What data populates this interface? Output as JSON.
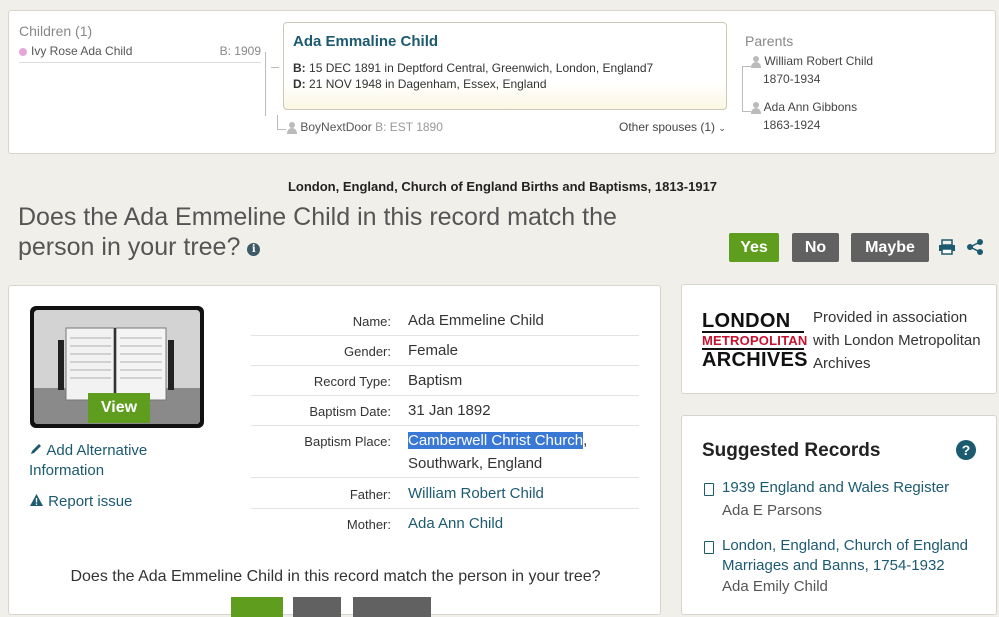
{
  "family": {
    "children_heading": "Children (1)",
    "children": [
      {
        "name": "Ivy Rose Ada Child",
        "birth": "B: 1909"
      }
    ],
    "focus": {
      "name": "Ada Emmaline Child",
      "birth_label": "B:",
      "birth": "15 DEC 1891 in Deptford Central, Greenwich, London, England7",
      "death_label": "D:",
      "death": "21 NOV 1948 in Dagenham, Essex, England"
    },
    "spouse": {
      "name": "BoyNextDoor",
      "est_label": "B:",
      "est": "EST 1890"
    },
    "other_spouses": "Other spouses (1)",
    "parents_heading": "Parents",
    "parents": [
      {
        "name": "William Robert Child",
        "years": "1870-1934"
      },
      {
        "name": "Ada Ann Gibbons",
        "years": "1863-1924"
      }
    ]
  },
  "collection_title": "London, England, Church of England Births and Baptisms, 1813-1917",
  "question": "Does the Ada Emmeline Child in this record match the person in your tree?",
  "buttons": {
    "yes": "Yes",
    "no": "No",
    "maybe": "Maybe"
  },
  "record": {
    "view_label": "View",
    "add_info": "Add Alternative Information",
    "report": "Report issue",
    "facts": [
      {
        "label": "Name:",
        "value": "Ada Emmeline Child"
      },
      {
        "label": "Gender:",
        "value": "Female"
      },
      {
        "label": "Record Type:",
        "value": "Baptism"
      },
      {
        "label": "Baptism Date:",
        "value": "31 Jan 1892"
      },
      {
        "label": "Baptism Place:",
        "value_highlight": "Camberwell Christ Church",
        "value_rest": ",",
        "value_line2": "Southwark, England"
      },
      {
        "label": "Father:",
        "value": "William Robert Child"
      },
      {
        "label": "Mother:",
        "value": "Ada Ann Child"
      }
    ],
    "bottom_question": "Does the Ada Emmeline Child in this record match the person in your tree?"
  },
  "source": {
    "logo_line1": "LONDON",
    "logo_line2": "METROPOLITAN",
    "logo_line3": "ARCHIVES",
    "provided": "Provided in association with London Metropolitan Archives"
  },
  "suggested": {
    "title": "Suggested Records",
    "help_icon": "?",
    "items": [
      {
        "title": "1939 England and Wales Register",
        "sub": "Ada E Parsons"
      },
      {
        "title": "London, England, Church of England Marriages and Banns, 1754-1932",
        "sub": "Ada Emily Child"
      }
    ]
  },
  "colors": {
    "green": "#5e9d1e",
    "gray": "#616161",
    "link": "#1c5a70",
    "background": "#f1efea"
  }
}
